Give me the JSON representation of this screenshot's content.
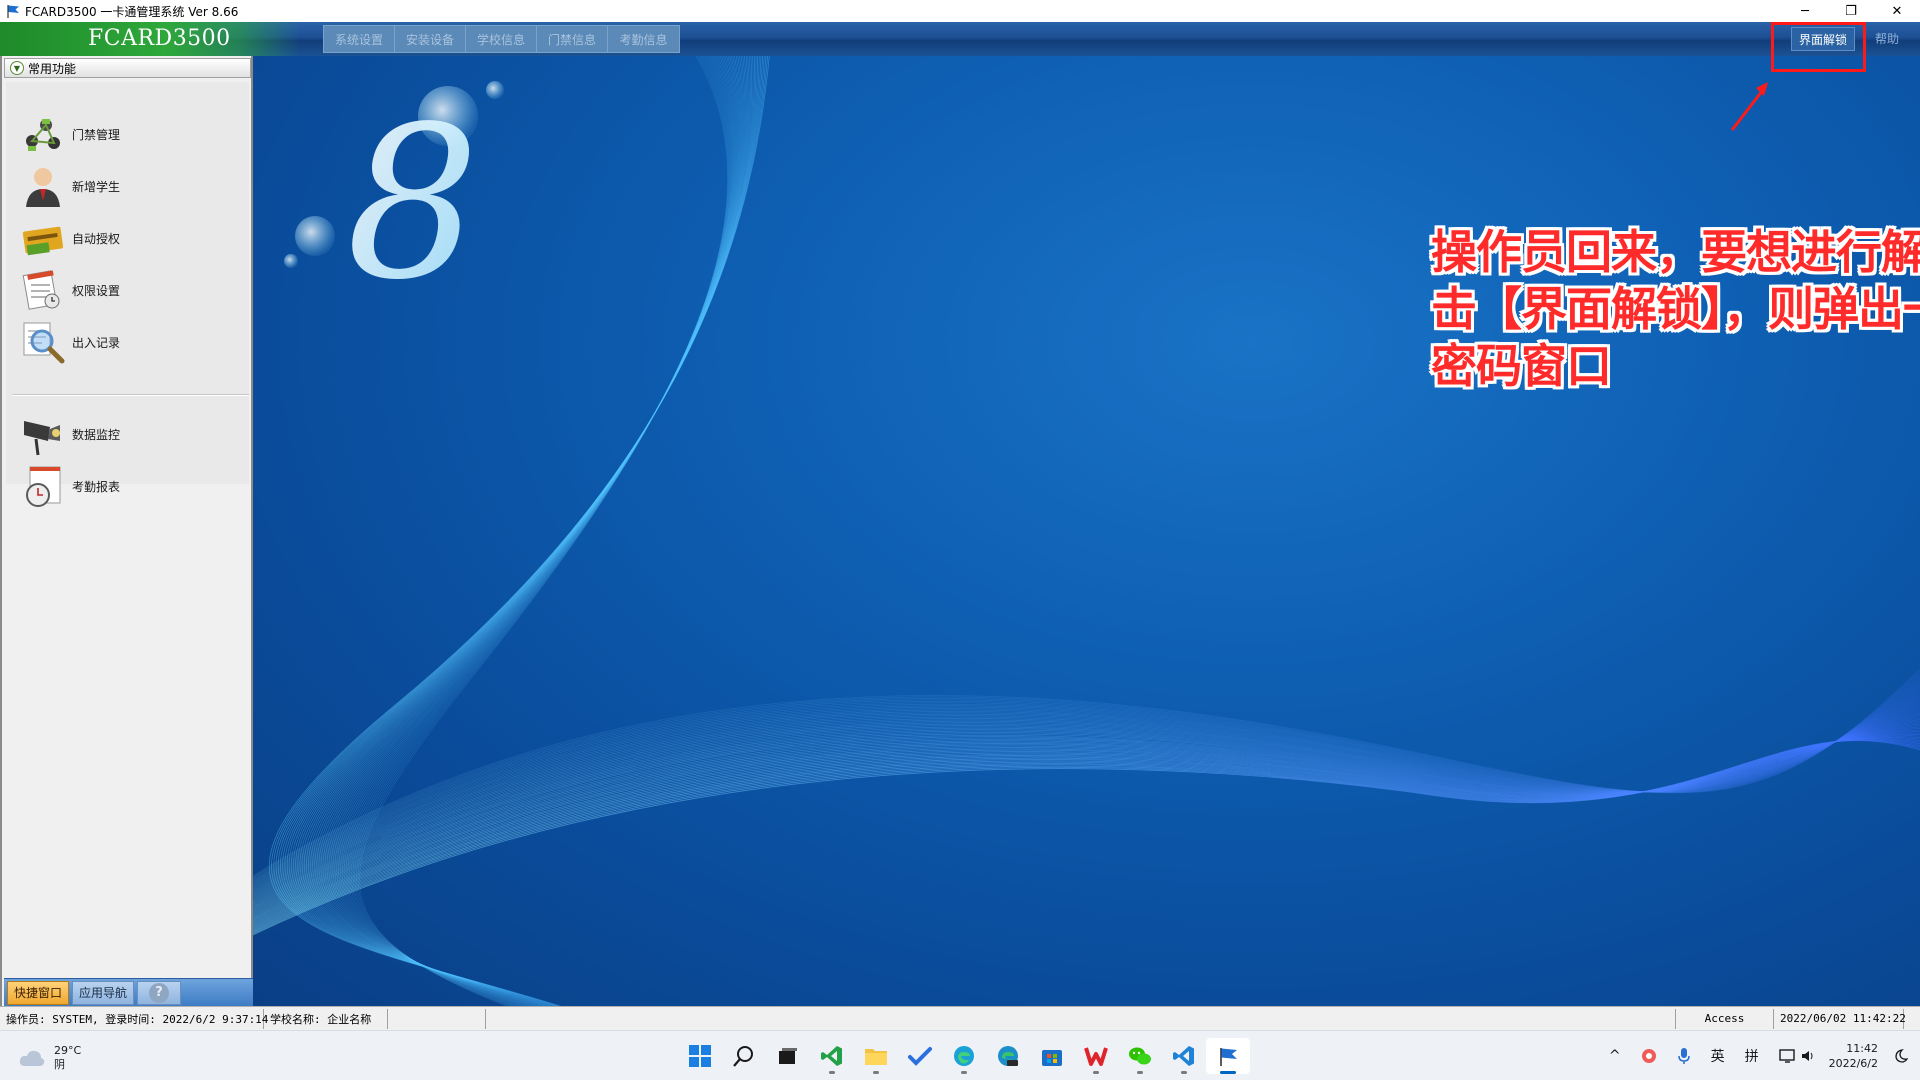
{
  "window": {
    "title": "FCARD3500 一卡通管理系统  Ver 8.66",
    "minimize": "─",
    "restore": "❐",
    "close": "✕"
  },
  "menubar": {
    "brand": "FCARD3500",
    "items": [
      "系统设置",
      "安装设备",
      "学校信息",
      "门禁信息",
      "考勤信息"
    ],
    "unlock_label": "界面解锁",
    "help_label": "帮助"
  },
  "sidebar": {
    "header": "常用功能",
    "items": [
      {
        "label": "门禁管理",
        "icon": "network-icon"
      },
      {
        "label": "新增学生",
        "icon": "user-icon"
      },
      {
        "label": "自动授权",
        "icon": "card-icon"
      },
      {
        "label": "权限设置",
        "icon": "document-clock-icon"
      },
      {
        "label": "出入记录",
        "icon": "magnifier-icon"
      },
      {
        "label": "数据监控",
        "icon": "camera-icon"
      },
      {
        "label": "考勤报表",
        "icon": "clock-report-icon"
      }
    ],
    "tabs": {
      "shortcut": "快捷窗口",
      "navigation": "应用导航",
      "help": "?"
    }
  },
  "annotation": {
    "text": "操作员回来，要想进行解锁，点击【界面解锁】，则弹出一个验证密码窗口"
  },
  "logo": {
    "glyph": "8"
  },
  "statusbar": {
    "operator": "操作员: SYSTEM, 登录时间: 2022/6/2 9:37:14",
    "school": "学校名称: 企业名称",
    "db": "Access",
    "datetime": "2022/06/02 11:42:22"
  },
  "taskbar": {
    "temperature": "29°C",
    "weather": "阴",
    "tray_lang": "英",
    "tray_ime": "拼",
    "time": "11:42",
    "date": "2022/6/2",
    "tray_up": "^"
  },
  "colors": {
    "accent": "#0067c0",
    "annotation": "#ff2a2a",
    "brand_green": "#2ea83a"
  }
}
